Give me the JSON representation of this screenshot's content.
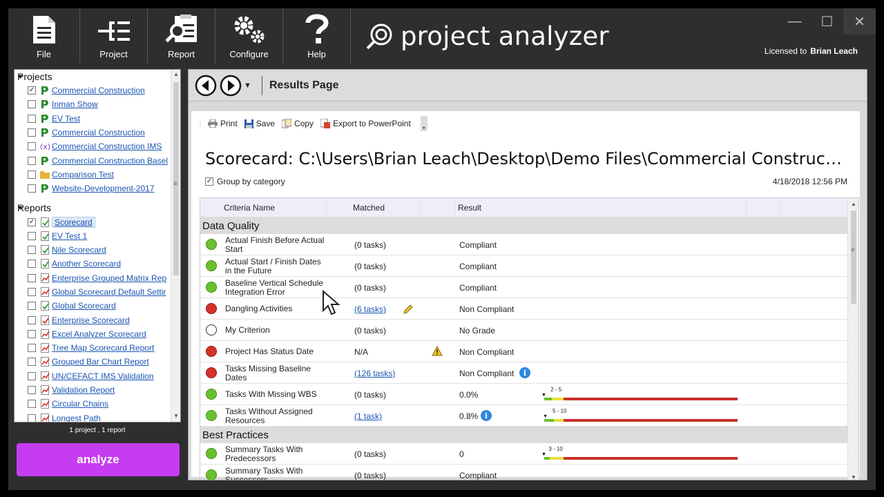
{
  "toolbar": {
    "file_label": "File",
    "project_label": "Project",
    "report_label": "Report",
    "configure_label": "Configure",
    "help_label": "Help"
  },
  "app_logo": "project analyzer",
  "license": {
    "prefix": "Licensed to",
    "user": "Brian Leach"
  },
  "window_controls": {
    "minimize": "—",
    "maximize": "☐",
    "close": "✕"
  },
  "projects": {
    "header": "Projects",
    "items": [
      {
        "label": "Commercial Construction",
        "checked": true,
        "icon": "project-p-icon"
      },
      {
        "label": "Inman Show",
        "checked": false,
        "icon": "project-p-icon"
      },
      {
        "label": "EV Test",
        "checked": false,
        "icon": "project-p-icon"
      },
      {
        "label": "Commercial Construction",
        "checked": false,
        "icon": "project-p-icon"
      },
      {
        "label": "Commercial Construction IMS",
        "checked": false,
        "icon": "ims-x-icon"
      },
      {
        "label": "Commercial Construction Basel",
        "checked": false,
        "icon": "project-p-icon"
      },
      {
        "label": "Comparison Test",
        "checked": false,
        "icon": "folder-icon"
      },
      {
        "label": "Website-Development-2017",
        "checked": false,
        "icon": "project-p-icon"
      }
    ]
  },
  "reports": {
    "header": "Reports",
    "items": [
      {
        "label": "Scorecard",
        "checked": true,
        "icon": "scorecard-icon"
      },
      {
        "label": "EV Test 1",
        "checked": false,
        "icon": "scorecard-icon"
      },
      {
        "label": "Nile Scorecard",
        "checked": false,
        "icon": "scorecard-icon"
      },
      {
        "label": "Another Scorecard",
        "checked": false,
        "icon": "scorecard-icon"
      },
      {
        "label": "Enterprise Grouped Matrix Rep",
        "checked": false,
        "icon": "chart-icon"
      },
      {
        "label": "Global Scorecard Default Settir",
        "checked": false,
        "icon": "chart-icon"
      },
      {
        "label": "Global Scorecard",
        "checked": false,
        "icon": "scorecard-icon"
      },
      {
        "label": "Enterprise Scorecard",
        "checked": false,
        "icon": "enterprise-scorecard-icon"
      },
      {
        "label": "Excel Analyzer Scorecard",
        "checked": false,
        "icon": "chart-icon"
      },
      {
        "label": "Tree Map Scorecard Report",
        "checked": false,
        "icon": "chart-icon"
      },
      {
        "label": "Grouped Bar Chart Report",
        "checked": false,
        "icon": "chart-icon"
      },
      {
        "label": "UN/CEFACT IMS Validation",
        "checked": false,
        "icon": "chart-icon"
      },
      {
        "label": "Validation Report",
        "checked": false,
        "icon": "chart-icon"
      },
      {
        "label": "Circular Chains",
        "checked": false,
        "icon": "chart-icon"
      },
      {
        "label": "Longest Path",
        "checked": false,
        "icon": "chart-icon"
      }
    ]
  },
  "selection_summary": "1 project , 1 report",
  "analyze_label": "analyze",
  "results": {
    "title": "Results Page",
    "actions": {
      "print": "Print",
      "save": "Save",
      "copy": "Copy",
      "export": "Export to PowerPoint"
    },
    "scorecard_title": "Scorecard: C:\\Users\\Brian Leach\\Desktop\\Demo Files\\Commercial Constructi...",
    "group_by_label": "Group by category",
    "group_by_checked": true,
    "date": "4/18/2018 12:56 PM",
    "columns": {
      "criteria": "Criteria Name",
      "matched": "Matched",
      "result": "Result"
    }
  },
  "grid": {
    "categories": [
      {
        "name": "Data Quality",
        "rows": [
          {
            "status": "green",
            "name": "Actual Finish Before Actual Start",
            "matched": "(0 tasks)",
            "matched_link": false,
            "result": "Compliant"
          },
          {
            "status": "green",
            "name": "Actual Start / Finish Dates in the Future",
            "matched": "(0 tasks)",
            "matched_link": false,
            "result": "Compliant"
          },
          {
            "status": "green",
            "name": "Baseline Vertical Schedule Integration Error",
            "matched": "(0 tasks)",
            "matched_link": false,
            "result": "Compliant"
          },
          {
            "status": "red",
            "name": "Dangling Activities",
            "matched": "(6 tasks)",
            "matched_link": true,
            "result": "Non Compliant",
            "icon": "pencil-icon"
          },
          {
            "status": "none",
            "name": "My Criterion",
            "matched": "(0 tasks)",
            "matched_link": false,
            "result": "No Grade"
          },
          {
            "status": "red",
            "name": "Project Has Status Date",
            "matched": "N/A",
            "matched_link": false,
            "result": "Non Compliant",
            "icon": "warning-icon"
          },
          {
            "status": "red",
            "name": "Tasks Missing Baseline Dates",
            "matched": "(126 tasks)",
            "matched_link": true,
            "result": "Non Compliant",
            "result_info": true
          },
          {
            "status": "green",
            "name": "Tasks With Missing WBS",
            "matched": "(0 tasks)",
            "matched_link": false,
            "result": "0.0%",
            "threshold": "2 - 5",
            "marker": 0
          },
          {
            "status": "green",
            "name": "Tasks Without Assigned Resources",
            "matched": "(1 task)",
            "matched_link": true,
            "result": "0.8%",
            "result_info": true,
            "threshold": "5 - 10",
            "marker": 0.8
          }
        ]
      },
      {
        "name": "Best Practices",
        "rows": [
          {
            "status": "green",
            "name": "Summary Tasks With Predecessors",
            "matched": "(0 tasks)",
            "matched_link": false,
            "result": "0",
            "threshold": "3 - 10",
            "marker": 0
          },
          {
            "status": "green",
            "name": "Summary Tasks With Successors",
            "matched": "(0 tasks)",
            "matched_link": false,
            "result": "Compliant"
          }
        ]
      }
    ]
  }
}
